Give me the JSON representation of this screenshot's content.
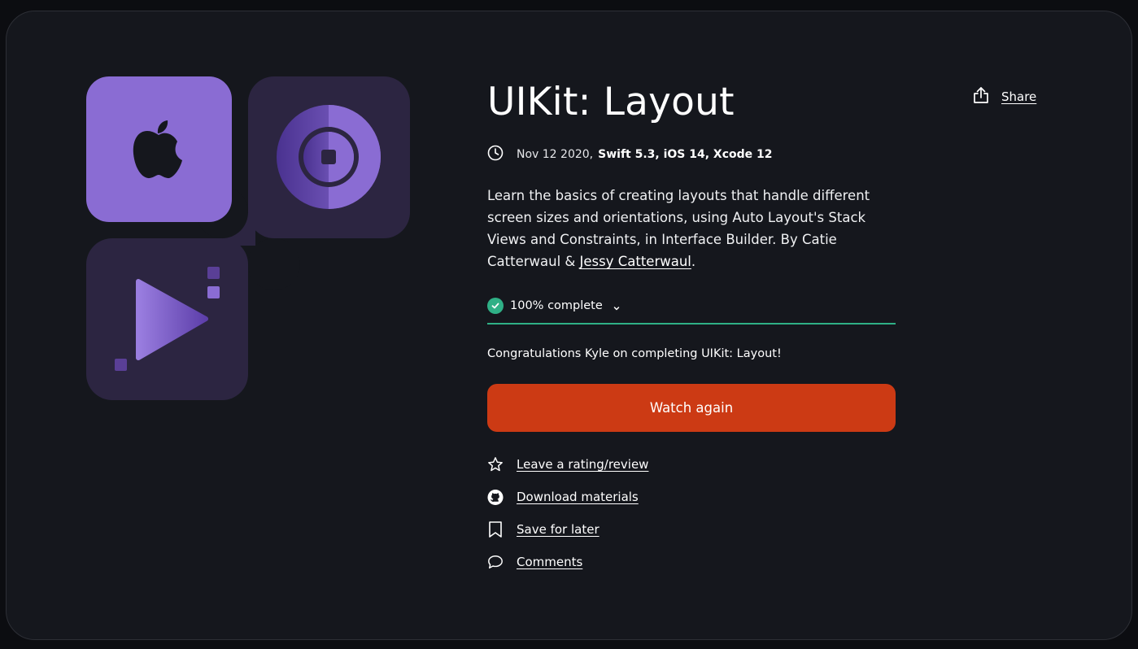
{
  "course": {
    "title": "UIKit: Layout",
    "date": "Nov 12 2020,",
    "tech": "Swift 5.3, iOS 14, Xcode 12",
    "description_text": "Learn the basics of creating layouts that handle different screen sizes and orientations, using Auto Layout's Stack Views and Constraints, in Interface Builder. By Catie Catterwaul & ",
    "author_link": "Jessy Catterwaul",
    "description_end": "."
  },
  "share": {
    "label": "Share",
    "icon": "share-icon"
  },
  "progress": {
    "label": "100% complete",
    "percent": 100,
    "icon": "check-circle-icon",
    "color": "#2fb086"
  },
  "congrats": "Congratulations Kyle on completing UIKit: Layout!",
  "watch_button": {
    "label": "Watch again",
    "color": "#cc3a14"
  },
  "actions": [
    {
      "label": "Leave a rating/review",
      "icon": "star-icon"
    },
    {
      "label": "Download materials",
      "icon": "github-icon"
    },
    {
      "label": "Save for later",
      "icon": "bookmark-icon"
    },
    {
      "label": "Comments",
      "icon": "comment-icon"
    }
  ],
  "artwork_icons": [
    "apple-logo-icon",
    "dial-icon",
    "play-icon"
  ],
  "colors": {
    "background": "#15171d",
    "accent_purple": "#8a6cd3",
    "tile_dark": "#2c2541"
  }
}
